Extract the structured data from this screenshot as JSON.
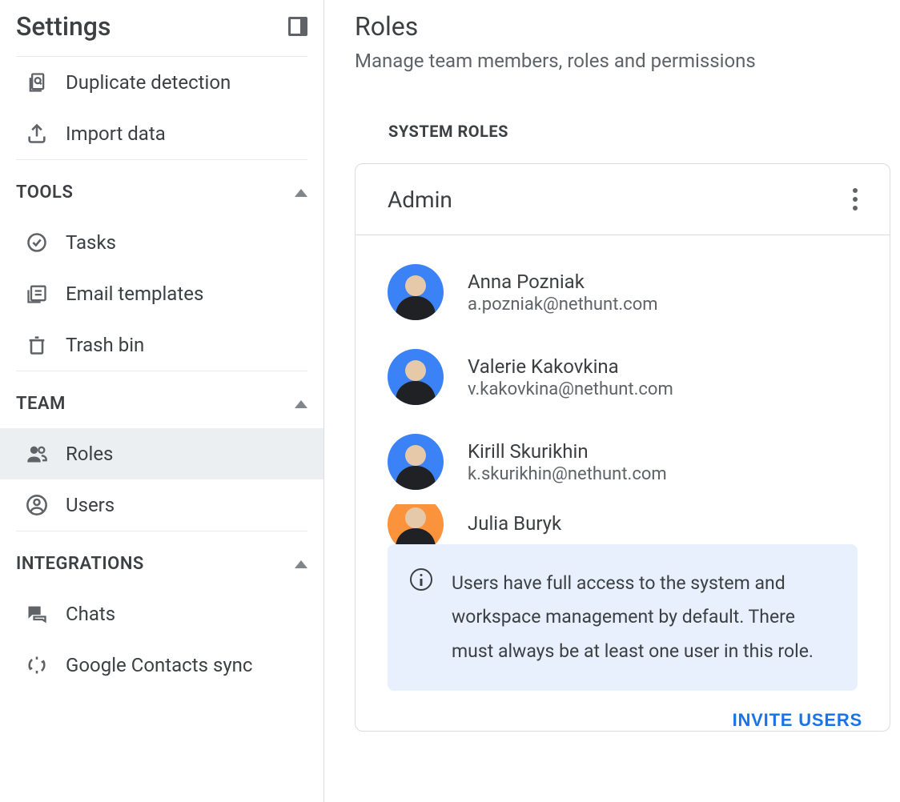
{
  "sidebar": {
    "title": "Settings",
    "nav_top": {
      "duplicate": "Duplicate detection",
      "import": "Import data"
    },
    "tools": {
      "label": "TOOLS",
      "tasks": "Tasks",
      "email_templates": "Email templates",
      "trash": "Trash bin"
    },
    "team": {
      "label": "TEAM",
      "roles": "Roles",
      "users": "Users"
    },
    "integrations": {
      "label": "INTEGRATIONS",
      "chats": "Chats",
      "google_contacts": "Google Contacts sync"
    }
  },
  "main": {
    "title": "Roles",
    "subtitle": "Manage team members, roles and permissions",
    "section_label": "SYSTEM ROLES",
    "role": {
      "name": "Admin",
      "users": [
        {
          "name": "Anna Pozniak",
          "email": "a.pozniak@nethunt.com",
          "avatar_bg": "#3b82f6"
        },
        {
          "name": "Valerie Kakovkina",
          "email": "v.kakovkina@nethunt.com",
          "avatar_bg": "#3b82f6"
        },
        {
          "name": "Kirill Skurikhin",
          "email": "k.skurikhin@nethunt.com",
          "avatar_bg": "#3b82f6"
        },
        {
          "name": "Julia Buryk",
          "email": "",
          "avatar_bg": "#fb923c"
        }
      ],
      "info": "Users have full access to the system and workspace management by default. There must always be at least one user in this role.",
      "invite_label": "INVITE USERS"
    }
  }
}
